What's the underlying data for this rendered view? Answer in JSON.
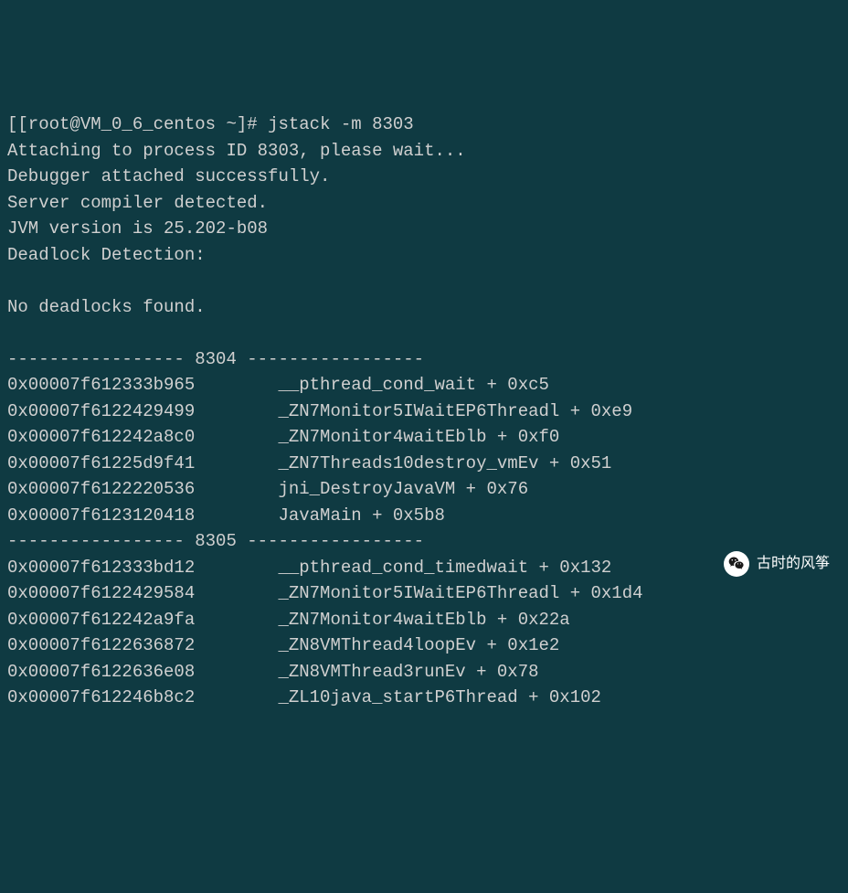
{
  "prompt": {
    "open_bracket": "[",
    "user_host": "[root@VM_0_6_centos ~]#",
    "command": "jstack -m 8303"
  },
  "header_lines": [
    "Attaching to process ID 8303, please wait...",
    "Debugger attached successfully.",
    "Server compiler detected.",
    "JVM version is 25.202-b08",
    "Deadlock Detection:",
    "",
    "No deadlocks found.",
    ""
  ],
  "threads": [
    {
      "separator": "----------------- 8304 -----------------",
      "frames": [
        {
          "addr": "0x00007f612333b965",
          "symbol": "__pthread_cond_wait + 0xc5"
        },
        {
          "addr": "0x00007f6122429499",
          "symbol": "_ZN7Monitor5IWaitEP6Threadl + 0xe9"
        },
        {
          "addr": "0x00007f612242a8c0",
          "symbol": "_ZN7Monitor4waitEblb + 0xf0"
        },
        {
          "addr": "0x00007f61225d9f41",
          "symbol": "_ZN7Threads10destroy_vmEv + 0x51"
        },
        {
          "addr": "0x00007f6122220536",
          "symbol": "jni_DestroyJavaVM + 0x76"
        },
        {
          "addr": "0x00007f6123120418",
          "symbol": "JavaMain + 0x5b8"
        }
      ]
    },
    {
      "separator": "----------------- 8305 -----------------",
      "frames": [
        {
          "addr": "0x00007f612333bd12",
          "symbol": "__pthread_cond_timedwait + 0x132"
        },
        {
          "addr": "0x00007f6122429584",
          "symbol": "_ZN7Monitor5IWaitEP6Threadl + 0x1d4"
        },
        {
          "addr": "0x00007f612242a9fa",
          "symbol": "_ZN7Monitor4waitEblb + 0x22a"
        },
        {
          "addr": "0x00007f6122636872",
          "symbol": "_ZN8VMThread4loopEv + 0x1e2"
        },
        {
          "addr": "0x00007f6122636e08",
          "symbol": "_ZN8VMThread3runEv + 0x78"
        },
        {
          "addr": "0x00007f612246b8c2",
          "symbol": "_ZL10java_startP6Thread + 0x102"
        }
      ]
    }
  ],
  "watermark": {
    "text": "古时的风筝"
  }
}
